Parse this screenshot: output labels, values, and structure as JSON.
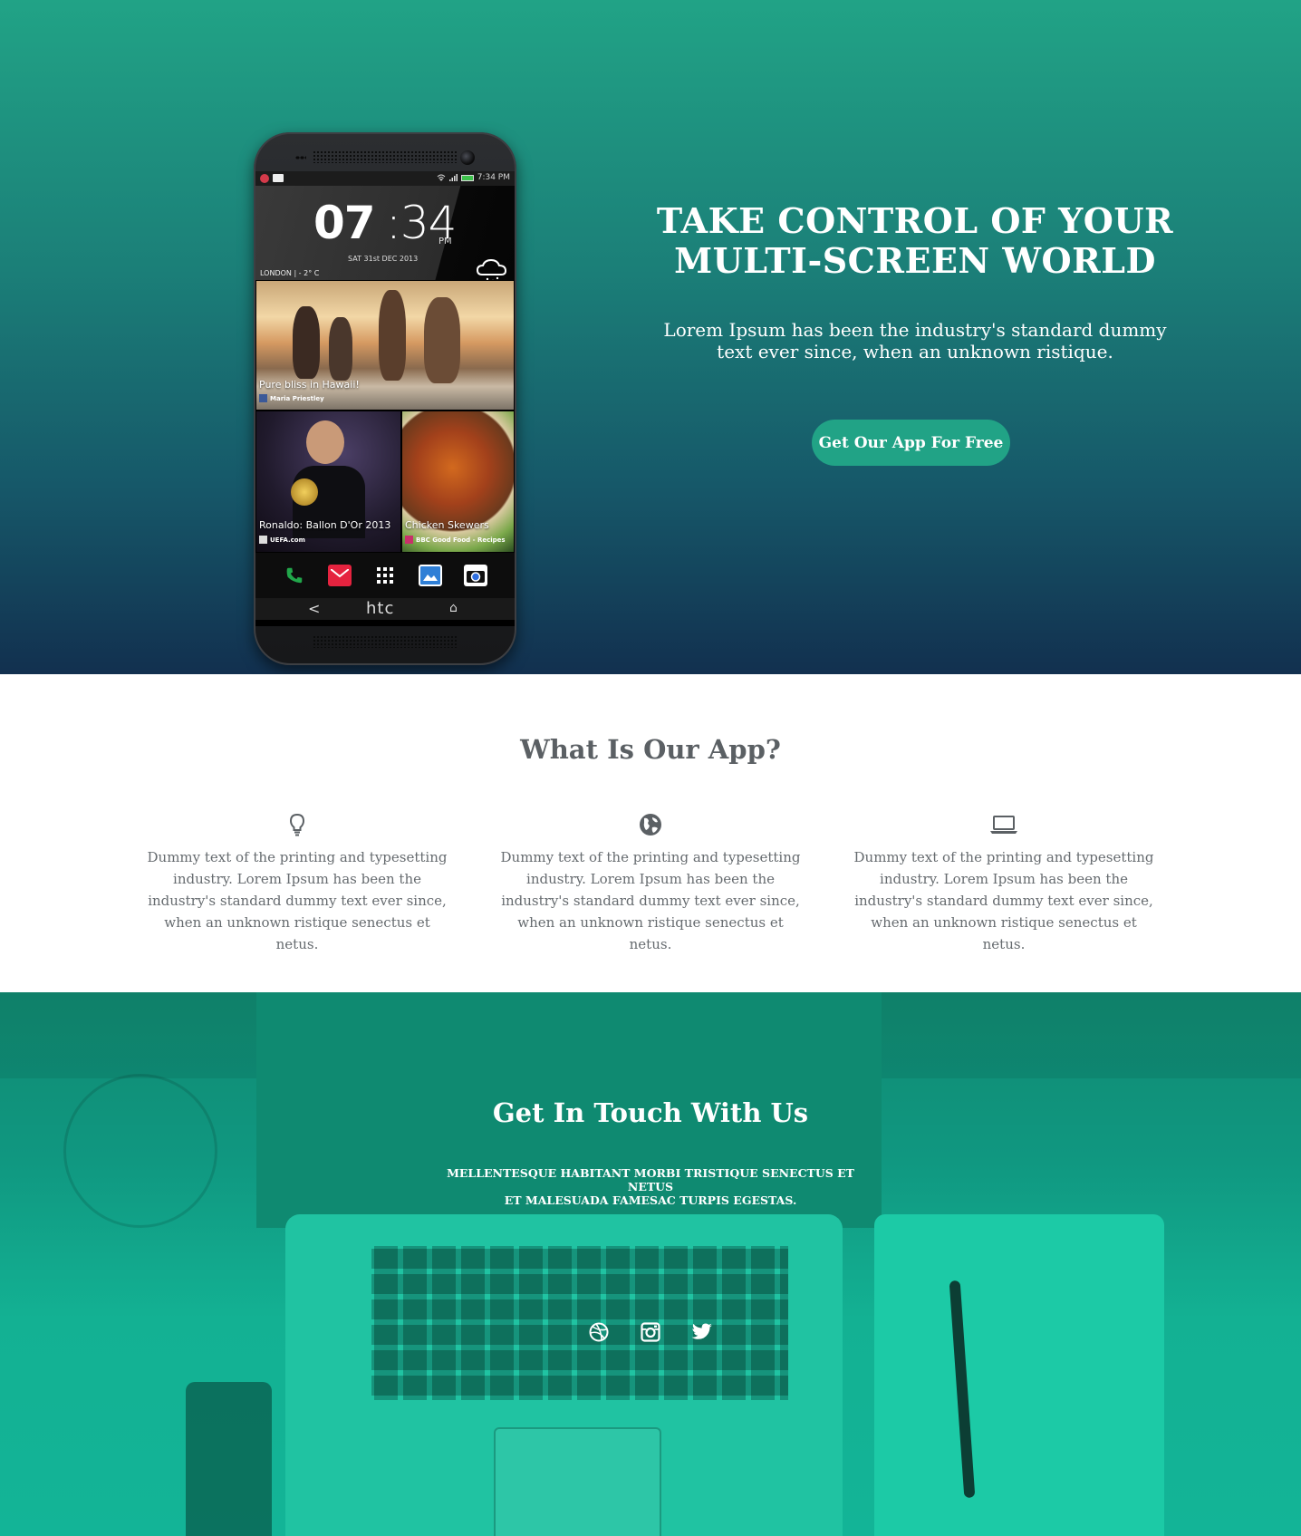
{
  "hero": {
    "title_line1": "TAKE CONTROL OF YOUR",
    "title_line2": "MULTI-SCREEN WORLD",
    "subtitle": "Lorem Ipsum has been the industry's standard dummy text ever since, when an unknown ristique.",
    "cta_label": "Get Our App For Free",
    "phone": {
      "status_time": "7:34 PM",
      "clock_hours": "07",
      "clock_minutes": ":34",
      "clock_ampm": "PM",
      "date": "SAT 31st DEC 2013",
      "city": "LONDON | - 2° C",
      "tiles": [
        {
          "caption": "Pure bliss in Hawaii!",
          "source": "Maria Priestley"
        },
        {
          "caption": "Ronaldo: Ballon D'Or 2013",
          "source": "UEFA.com"
        },
        {
          "caption": "Chicken Skewers",
          "source": "BBC Good Food - Recipes"
        }
      ],
      "nav_back": "<",
      "brand": "htc",
      "nav_home": "⌂"
    }
  },
  "about": {
    "title": "What Is Our App?",
    "features": [
      {
        "icon": "lightbulb-icon",
        "text": "Dummy text of the printing and typesetting industry. Lorem Ipsum has been the industry's standard dummy text ever since, when an unknown ristique senectus et netus."
      },
      {
        "icon": "globe-icon",
        "text": "Dummy text of the printing and typesetting industry. Lorem Ipsum has been the industry's standard dummy text ever since, when an unknown ristique senectus et netus."
      },
      {
        "icon": "laptop-icon",
        "text": "Dummy text of the printing and typesetting industry. Lorem Ipsum has been the industry's standard dummy text ever since, when an unknown ristique senectus et netus."
      }
    ]
  },
  "contact": {
    "title": "Get In Touch With Us",
    "subtitle_line1": "MELLENTESQUE HABITANT MORBI TRISTIQUE SENECTUS ET NETUS",
    "subtitle_line2": "ET MALESUADA FAMESAC TURPIS EGESTAS.",
    "socials": [
      "dribbble-icon",
      "instagram-icon",
      "twitter-icon"
    ]
  },
  "colors": {
    "accent": "#21a386",
    "hero_top": "#21a386",
    "hero_bottom": "#12304f",
    "heading_gray": "#5b6064",
    "body_gray": "#666b6f",
    "contact_overlay": "#13b497"
  }
}
